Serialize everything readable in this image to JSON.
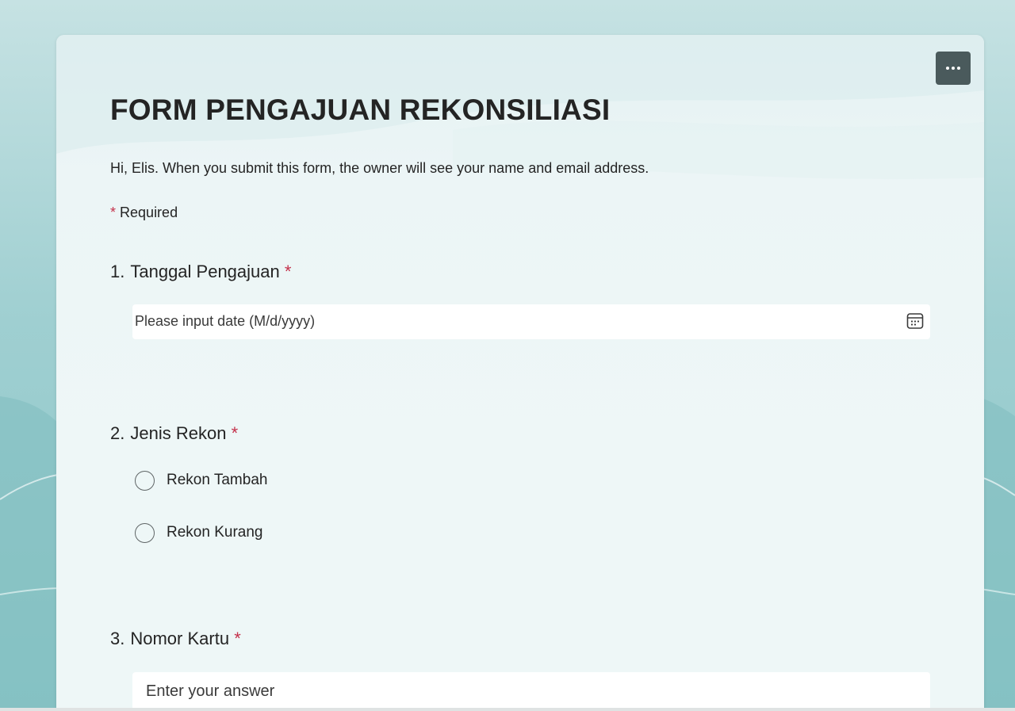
{
  "form": {
    "title": "FORM PENGAJUAN REKONSILIASI",
    "greeting": "Hi, Elis. When you submit this form, the owner will see your name and email address.",
    "required_asterisk": "*",
    "required_label": "Required",
    "more_options_icon": "more-horizontal-icon"
  },
  "questions": [
    {
      "number": "1.",
      "title": "Tanggal Pengajuan",
      "required_mark": "*",
      "type": "date",
      "placeholder": "Please input date (M/d/yyyy)",
      "icon": "calendar-icon"
    },
    {
      "number": "2.",
      "title": "Jenis Rekon",
      "required_mark": "*",
      "type": "choice",
      "options": [
        "Rekon Tambah",
        "Rekon Kurang"
      ]
    },
    {
      "number": "3.",
      "title": "Nomor Kartu",
      "required_mark": "*",
      "type": "text",
      "placeholder": "Enter your answer"
    }
  ],
  "colors": {
    "background": "#b7dadc",
    "card": "#eef7f7",
    "more_button": "#4a5a5c",
    "required_red": "#c4314b",
    "text": "#242424"
  }
}
